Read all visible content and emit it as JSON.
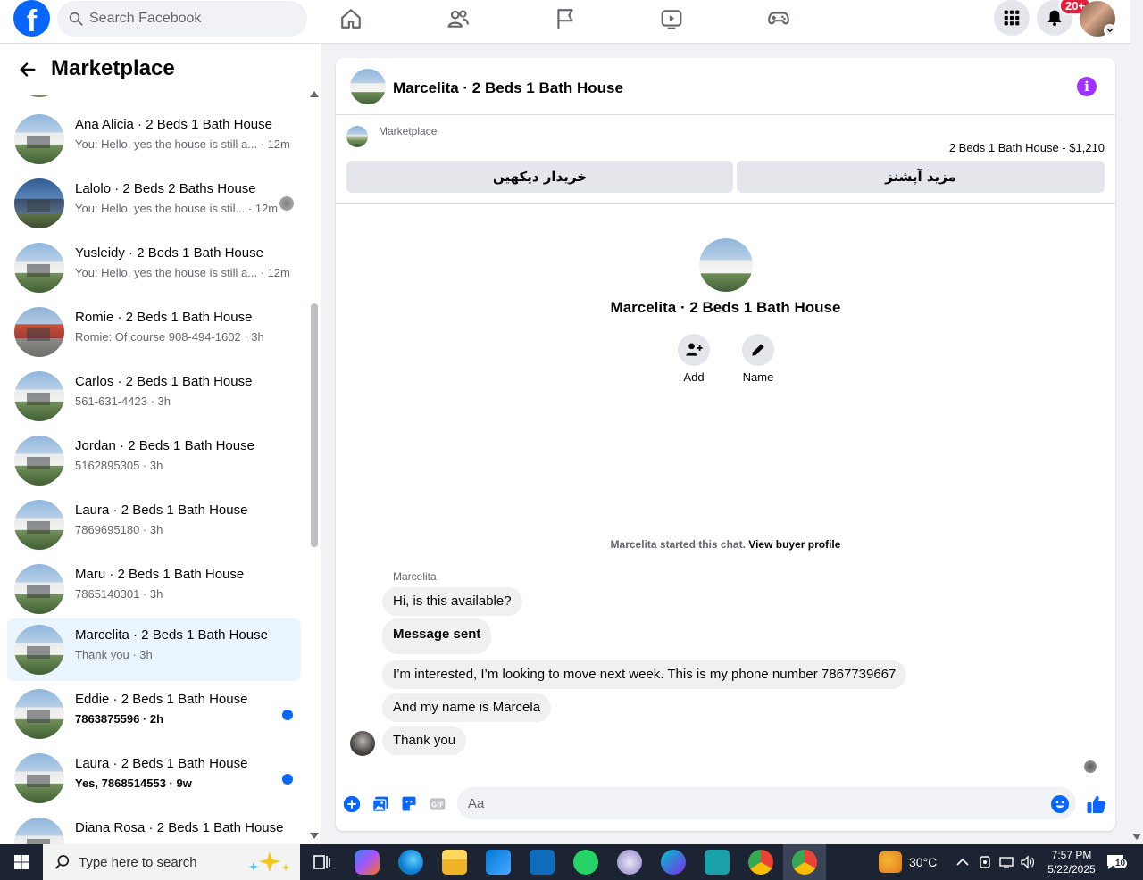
{
  "topbar": {
    "search_placeholder": "Search Facebook",
    "notification_count": "20+",
    "logo_letter": "f"
  },
  "left": {
    "title": "Marketplace",
    "conversations": [
      {
        "title": "Ana Alicia · 2 Beds 1 Bath House",
        "preview": "You: Hello, yes the house is still a... · 12m",
        "status": "read"
      },
      {
        "title": "Lalolo · 2 Beds 2 Baths House",
        "preview": "You: Hello, yes the house is stil... · 12m",
        "status": "seen"
      },
      {
        "title": "Yusleidy · 2 Beds 1 Bath House",
        "preview": "You: Hello, yes the house is still a... · 12m",
        "status": "read"
      },
      {
        "title": "Romie · 2 Beds 1 Bath House",
        "preview": "Romie: Of course 908-494-1602 · 3h",
        "status": "read"
      },
      {
        "title": "Carlos · 2 Beds 1 Bath House",
        "preview": "561-631-4423 · 3h",
        "status": "read"
      },
      {
        "title": "Jordan · 2 Beds 1 Bath House",
        "preview": "5162895305 · 3h",
        "status": "read"
      },
      {
        "title": "Laura · 2 Beds 1 Bath House",
        "preview": "7869695180 · 3h",
        "status": "read"
      },
      {
        "title": "Maru · 2 Beds 1 Bath House",
        "preview": "7865140301 · 3h",
        "status": "read"
      },
      {
        "title": "Marcelita · 2 Beds 1 Bath House",
        "preview": "Thank you · 3h",
        "status": "active"
      },
      {
        "title": "Eddie · 2 Beds 1 Bath House",
        "preview": "7863875596 · 2h",
        "status": "unread"
      },
      {
        "title": "Laura · 2 Beds 1 Bath House",
        "preview": "Yes, 7868514553 · 9w",
        "status": "unread"
      },
      {
        "title": "Diana Rosa · 2 Beds 1 Bath House",
        "preview": "",
        "status": "read"
      }
    ]
  },
  "chat": {
    "title": "Marcelita · 2 Beds 1 Bath House",
    "marketplace_label": "Marketplace",
    "listing_price": "2 Beds 1 Bath House - $1,210",
    "btn_view_buyer": "خریدار دیکھیں",
    "btn_more_options": "مزید آپشنز",
    "profile_name": "Marcelita · 2 Beds 1 Bath House",
    "action_add": "Add",
    "action_name": "Name",
    "started_text": "Marcelita started this chat.",
    "started_link": "View buyer profile",
    "sender_name": "Marcelita",
    "messages": [
      "Hi, is this available?",
      "Message sent",
      "I’m interested, I’m looking to move next week. This is my phone number 7867739667",
      "And my name is Marcela",
      "Thank you"
    ],
    "composer_placeholder": "Aa"
  },
  "taskbar": {
    "search_placeholder": "Type here to search",
    "weather": "30°C",
    "time": "7:57 PM",
    "date": "5/22/2025",
    "notifications": "10"
  },
  "colors": {
    "facebook_blue": "#0866ff",
    "unread_dot": "#0866ff",
    "active_row": "#ebf5ff",
    "info_purple": "#a033ff",
    "badge_red": "#e41e3f"
  }
}
